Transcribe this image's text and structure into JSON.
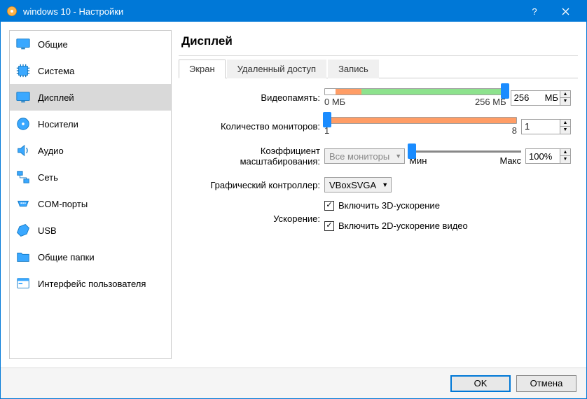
{
  "titlebar": {
    "title": "windows 10 - Настройки"
  },
  "sidebar": {
    "items": [
      {
        "label": "Общие"
      },
      {
        "label": "Система"
      },
      {
        "label": "Дисплей"
      },
      {
        "label": "Носители"
      },
      {
        "label": "Аудио"
      },
      {
        "label": "Сеть"
      },
      {
        "label": "COM-порты"
      },
      {
        "label": "USB"
      },
      {
        "label": "Общие папки"
      },
      {
        "label": "Интерфейс пользователя"
      }
    ]
  },
  "main": {
    "title": "Дисплей",
    "tabs": [
      {
        "label": "Экран"
      },
      {
        "label": "Удаленный доступ"
      },
      {
        "label": "Запись"
      }
    ],
    "screen": {
      "video_memory_label": "Видеопамять:",
      "video_memory_min": "0 МБ",
      "video_memory_max": "256 МБ",
      "video_memory_value": "256",
      "video_memory_unit": "МБ",
      "monitors_label": "Количество мониторов:",
      "monitors_min": "1",
      "monitors_max": "8",
      "monitors_value": "1",
      "scale_label": "Коэффициент масштабирования:",
      "scale_combo": "Все мониторы",
      "scale_min": "Мин",
      "scale_max": "Макс",
      "scale_value": "100%",
      "controller_label": "Графический контроллер:",
      "controller_value": "VBoxSVGA",
      "accel_label": "Ускорение:",
      "accel_3d": "Включить 3D-ускорение",
      "accel_2d": "Включить 2D-ускорение видео"
    }
  },
  "footer": {
    "ok": "OK",
    "cancel": "Отмена"
  }
}
